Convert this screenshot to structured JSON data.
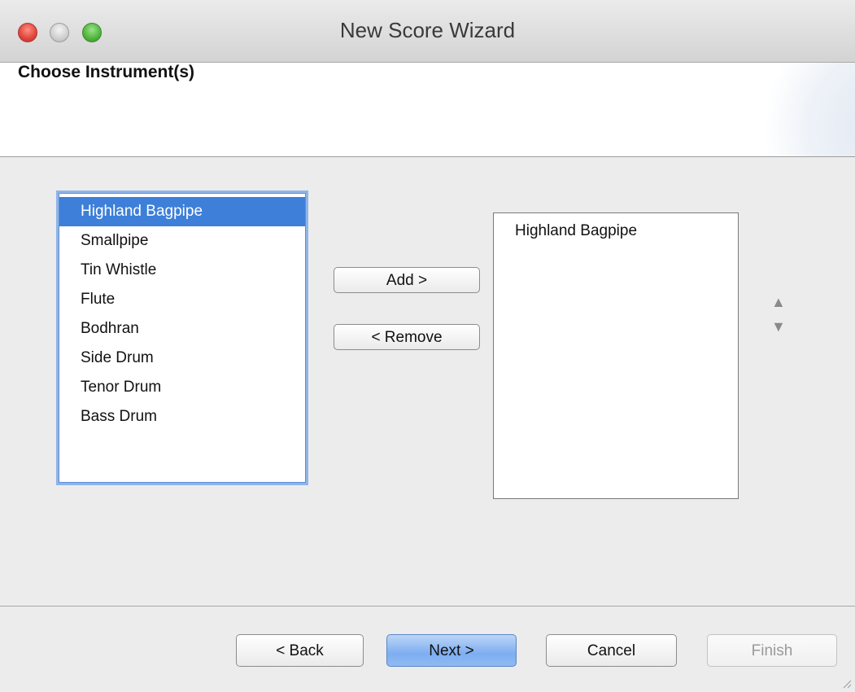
{
  "window": {
    "title": "New Score Wizard"
  },
  "header": {
    "page_title": "Choose Instrument(s)"
  },
  "available_instruments": {
    "items": [
      {
        "label": "Highland Bagpipe",
        "selected": true
      },
      {
        "label": "Smallpipe",
        "selected": false
      },
      {
        "label": "Tin Whistle",
        "selected": false
      },
      {
        "label": "Flute",
        "selected": false
      },
      {
        "label": "Bodhran",
        "selected": false
      },
      {
        "label": "Side Drum",
        "selected": false
      },
      {
        "label": "Tenor Drum",
        "selected": false
      },
      {
        "label": "Bass Drum",
        "selected": false
      }
    ]
  },
  "transfer": {
    "add_label": "Add  >",
    "remove_label": "<  Remove"
  },
  "chosen_instruments": {
    "items": [
      {
        "label": "Highland Bagpipe"
      }
    ]
  },
  "order": {
    "up_icon": "triangle-up-icon",
    "down_icon": "triangle-down-icon"
  },
  "footer": {
    "back_label": "< Back",
    "next_label": "Next >",
    "cancel_label": "Cancel",
    "finish_label": "Finish",
    "finish_enabled": false
  },
  "colors": {
    "selection": "#3d7fd9",
    "focus_ring": "#8fb4e8",
    "default_button": "#7eaef0"
  }
}
